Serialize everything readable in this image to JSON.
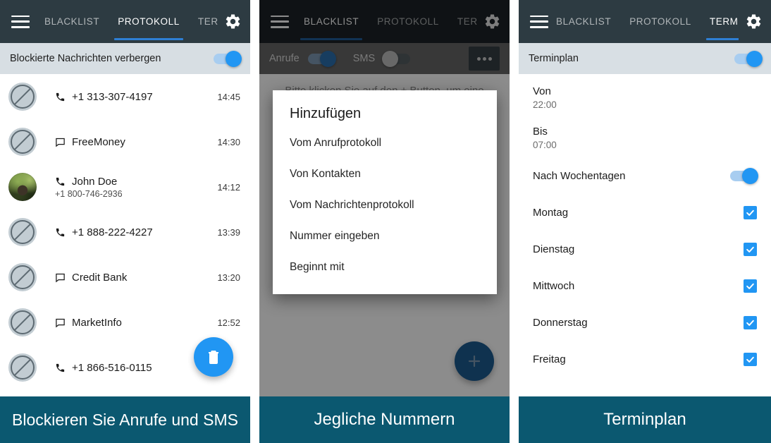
{
  "app": {
    "tabs": [
      "BLACKLIST",
      "PROTOKOLL",
      "TERMINPLAN"
    ],
    "menu_icon": "hamburger-icon",
    "settings_icon": "gear-icon",
    "accent_blue": "#2196f3",
    "appbar_color": "#2d3b42",
    "caption_color": "#0b5870"
  },
  "panel1": {
    "tabs": {
      "blacklist": "BLACKLIST",
      "protokoll": "PROTOKOLL",
      "terminplan": "TERMINPLAN",
      "active": "PROTOKOLL"
    },
    "subbar": {
      "label": "Blockierte Nachrichten verbergen",
      "toggle_state": "on"
    },
    "log": [
      {
        "avatar": "blocked-icon",
        "type_icon": "phone-icon",
        "title": "+1 313-307-4197",
        "subtitle": "",
        "time": "14:45"
      },
      {
        "avatar": "blocked-icon",
        "type_icon": "message-icon",
        "title": "FreeMoney",
        "subtitle": "",
        "time": "14:30"
      },
      {
        "avatar": "contact-photo",
        "type_icon": "phone-icon",
        "title": "John Doe",
        "subtitle": "+1 800-746-2936",
        "time": "14:12"
      },
      {
        "avatar": "blocked-icon",
        "type_icon": "phone-icon",
        "title": "+1 888-222-4227",
        "subtitle": "",
        "time": "13:39"
      },
      {
        "avatar": "blocked-icon",
        "type_icon": "message-icon",
        "title": "Credit Bank",
        "subtitle": "",
        "time": "13:20"
      },
      {
        "avatar": "blocked-icon",
        "type_icon": "message-icon",
        "title": "MarketInfo",
        "subtitle": "",
        "time": "12:52"
      },
      {
        "avatar": "blocked-icon",
        "type_icon": "phone-icon",
        "title": "+1 866-516-0115",
        "subtitle": "",
        "time": ""
      }
    ],
    "fab": {
      "icon": "trash-icon",
      "color": "#2196f3"
    },
    "caption": "Blockieren Sie Anrufe und SMS"
  },
  "panel2": {
    "tabs": {
      "blacklist": "BLACKLIST",
      "protokoll": "PROTOKOLL",
      "terminplan": "TERMINPLAN",
      "active": "BLACKLIST"
    },
    "subbar": {
      "calls_label": "Anrufe",
      "calls_state": "on",
      "sms_label": "SMS",
      "sms_state": "off",
      "overflow_icon": "more-options-icon"
    },
    "empty_hint": "Bitte klicken Sie auf den + Button, um eine Nummer hinzuzufügen",
    "dialog": {
      "title": "Hinzufügen",
      "items": [
        "Vom Anrufprotokoll",
        "Von Kontakten",
        "Vom Nachrichtenprotokoll",
        "Nummer eingeben",
        "Beginnt mit"
      ]
    },
    "fab": {
      "icon": "plus-icon",
      "color": "#1d5c91"
    },
    "caption": "Jegliche Nummern"
  },
  "panel3": {
    "tabs": {
      "blacklist": "BLACKLIST",
      "protokoll": "PROTOKOLL",
      "terminplan": "TERMINPLAN",
      "active": "TERMINPLAN"
    },
    "subbar": {
      "label": "Terminplan",
      "toggle_state": "on"
    },
    "from": {
      "label": "Von",
      "value": "22:00"
    },
    "to": {
      "label": "Bis",
      "value": "07:00"
    },
    "weekdays_toggle": {
      "label": "Nach Wochentagen",
      "state": "on"
    },
    "days": [
      {
        "name": "Montag",
        "checked": true
      },
      {
        "name": "Dienstag",
        "checked": true
      },
      {
        "name": "Mittwoch",
        "checked": true
      },
      {
        "name": "Donnerstag",
        "checked": true
      },
      {
        "name": "Freitag",
        "checked": true
      }
    ],
    "caption": "Terminplan"
  }
}
